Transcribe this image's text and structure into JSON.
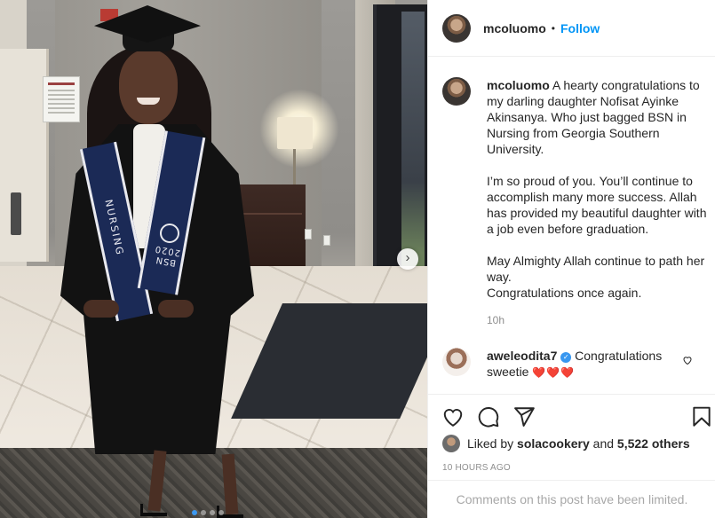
{
  "post": {
    "username": "mcoluomo",
    "follow_label": "Follow",
    "separator": "•",
    "photo_count": 4,
    "active_photo": 1
  },
  "photo": {
    "stole_left_text": "NURSING",
    "stole_right_text": "BSN 2020",
    "next_icon": "chevron-right-icon"
  },
  "caption": {
    "username": "mcoluomo",
    "paragraphs": [
      "A hearty congratulations to my darling daughter Nofisat Ayinke Akinsanya. Who just bagged BSN in Nursing from Georgia Southern University.",
      "I’m so proud of you. You’ll continue to accomplish many more success. Allah has provided my beautiful daughter with a job even before graduation.",
      "May Almighty Allah continue to path her way.\nCongratulations once again."
    ],
    "time": "10h"
  },
  "comment": {
    "username": "aweleodita7",
    "verified": true,
    "text": "Congratulations sweetie",
    "emoji": "❤️❤️❤️",
    "like_icon": "heart-outline-icon"
  },
  "actions": {
    "like_icon": "heart-icon",
    "comment_icon": "comment-icon",
    "share_icon": "paper-plane-icon",
    "save_icon": "bookmark-icon"
  },
  "likes": {
    "prefix": "Liked by",
    "user": "solacookery",
    "conjunction": "and",
    "others": "5,522 others"
  },
  "timestamp": "10 HOURS AGO",
  "comments_limited": "Comments on this post have been limited.",
  "colors": {
    "accent": "#0095f6",
    "secondary_text": "#8e8e8e",
    "heart": "#d01a1a",
    "stole": "#1b2a56"
  }
}
